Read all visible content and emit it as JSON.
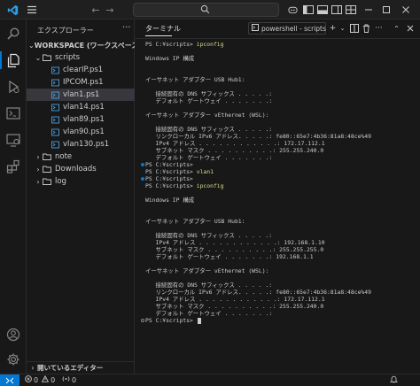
{
  "explorer": {
    "title": "エクスプローラー",
    "workspace": "WORKSPACE (ワークスペース)",
    "items": [
      {
        "label": "scripts",
        "type": "folder",
        "open": true
      },
      {
        "label": "clearIP.ps1",
        "type": "ps1"
      },
      {
        "label": "IPCOM.ps1",
        "type": "ps1"
      },
      {
        "label": "vlan1.ps1",
        "type": "ps1",
        "selected": true
      },
      {
        "label": "vlan14.ps1",
        "type": "ps1"
      },
      {
        "label": "vlan89.ps1",
        "type": "ps1"
      },
      {
        "label": "vlan90.ps1",
        "type": "ps1"
      },
      {
        "label": "vlan130.ps1",
        "type": "ps1"
      },
      {
        "label": "note",
        "type": "folder",
        "open": false
      },
      {
        "label": "Downloads",
        "type": "folder",
        "open": false
      },
      {
        "label": "log",
        "type": "folder",
        "open": false
      }
    ],
    "open_editors": "開いているエディター"
  },
  "panel": {
    "tab": "ターミナル",
    "shell": "powershell - scripts"
  },
  "terminal": {
    "lines": [
      {
        "prompt": "PS C:¥scripts> ",
        "cmd": "ipconfig"
      },
      {
        "text": ""
      },
      {
        "text": "Windows IP 構成"
      },
      {
        "text": ""
      },
      {
        "text": ""
      },
      {
        "text": "イーサネット アダプター USB Hub1:"
      },
      {
        "text": ""
      },
      {
        "text": "   接続固有の DNS サフィックス . . . . .:"
      },
      {
        "text": "   デフォルト ゲートウェイ . . . . . . .:"
      },
      {
        "text": ""
      },
      {
        "text": "イーサネット アダプター vEthernet (WSL):"
      },
      {
        "text": ""
      },
      {
        "text": "   接続固有の DNS サフィックス . . . . .:"
      },
      {
        "text": "   リンクローカル IPv6 アドレス. . . . .: fe80::65e7:4b36:81a8:48ce%49"
      },
      {
        "text": "   IPv4 アドレス . . . . . . . . . . . .: 172.17.112.1"
      },
      {
        "text": "   サブネット マスク . . . . . . . . . .: 255.255.240.0"
      },
      {
        "text": "   デフォルト ゲートウェイ . . . . . . .:"
      },
      {
        "prompt": "PS C:¥scripts> ",
        "dot": "blue"
      },
      {
        "prompt": "PS C:¥scripts> ",
        "cmd": "vlan1"
      },
      {
        "prompt": "PS C:¥scripts> ",
        "dot": "blue"
      },
      {
        "prompt": "PS C:¥scripts> ",
        "cmd": "ipconfig"
      },
      {
        "text": ""
      },
      {
        "text": "Windows IP 構成"
      },
      {
        "text": ""
      },
      {
        "text": ""
      },
      {
        "text": "イーサネット アダプター USB Hub1:"
      },
      {
        "text": ""
      },
      {
        "text": "   接続固有の DNS サフィックス . . . . .:"
      },
      {
        "text": "   IPv4 アドレス . . . . . . . . . . . .: 192.168.1.10"
      },
      {
        "text": "   サブネット マスク . . . . . . . . . .: 255.255.255.0"
      },
      {
        "text": "   デフォルト ゲートウェイ . . . . . . .: 192.168.1.1"
      },
      {
        "text": ""
      },
      {
        "text": "イーサネット アダプター vEthernet (WSL):"
      },
      {
        "text": ""
      },
      {
        "text": "   接続固有の DNS サフィックス . . . . .:"
      },
      {
        "text": "   リンクローカル IPv6 アドレス. . . . .: fe80::65e7:4b36:81a8:48ce%49"
      },
      {
        "text": "   IPv4 アドレス . . . . . . . . . . . .: 172.17.112.1"
      },
      {
        "text": "   サブネット マスク . . . . . . . . . .: 255.255.240.0"
      },
      {
        "text": "   デフォルト ゲートウェイ . . . . . . .:"
      },
      {
        "prompt": "PS C:¥scripts> ",
        "dot": "grey",
        "cursor": true
      }
    ]
  },
  "status": {
    "errors": "0",
    "warnings": "0",
    "ports": "0"
  },
  "colors": {
    "accent": "#0078d4",
    "ps1_icon": "#4a9fe0",
    "folder_icon": "#c5c5c5",
    "command": "#dcdc8b"
  }
}
